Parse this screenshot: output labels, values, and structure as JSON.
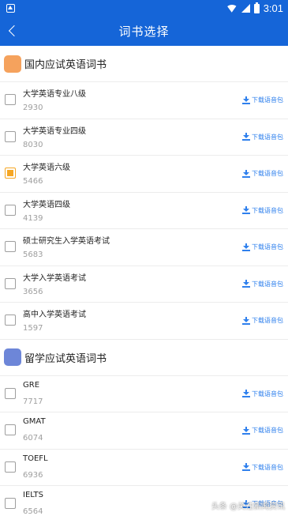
{
  "status_bar": {
    "time": "3:01",
    "notification_icon": "notification-icon",
    "wifi_icon": "wifi-icon",
    "signal_icon": "signal-icon",
    "battery_icon": "battery-icon"
  },
  "app_bar": {
    "title": "词书选择",
    "back_icon": "back-arrow-icon",
    "color": "#1565d8"
  },
  "sections": [
    {
      "title": "国内应试英语词书",
      "icon": "domestic-exam-icon",
      "icon_color": "#f5a25d",
      "items": [
        {
          "name": "大学英语专业八级",
          "count": "2930",
          "checked": false,
          "download_label": "下载语音包"
        },
        {
          "name": "大学英语专业四级",
          "count": "8030",
          "checked": false,
          "download_label": "下载语音包"
        },
        {
          "name": "大学英语六级",
          "count": "5466",
          "checked": true,
          "download_label": "下载语音包"
        },
        {
          "name": "大学英语四级",
          "count": "4139",
          "checked": false,
          "download_label": "下载语音包"
        },
        {
          "name": "硕士研究生入学英语考试",
          "count": "5683",
          "checked": false,
          "download_label": "下载语音包"
        },
        {
          "name": "大学入学英语考试",
          "count": "3656",
          "checked": false,
          "download_label": "下载语音包"
        },
        {
          "name": "高中入学英语考试",
          "count": "1597",
          "checked": false,
          "download_label": "下载语音包"
        }
      ]
    },
    {
      "title": "留学应试英语词书",
      "icon": "abroad-exam-icon",
      "icon_color": "#6d86d8",
      "items": [
        {
          "name": "GRE",
          "count": "7717",
          "checked": false,
          "download_label": "下载语音包"
        },
        {
          "name": "GMAT",
          "count": "6074",
          "checked": false,
          "download_label": "下载语音包"
        },
        {
          "name": "TOEFL",
          "count": "6936",
          "checked": false,
          "download_label": "下载语音包"
        },
        {
          "name": "IELTS",
          "count": "6564",
          "checked": false,
          "download_label": "下载语音包"
        }
      ]
    }
  ],
  "watermark": "头条 @关注新闻资讯"
}
